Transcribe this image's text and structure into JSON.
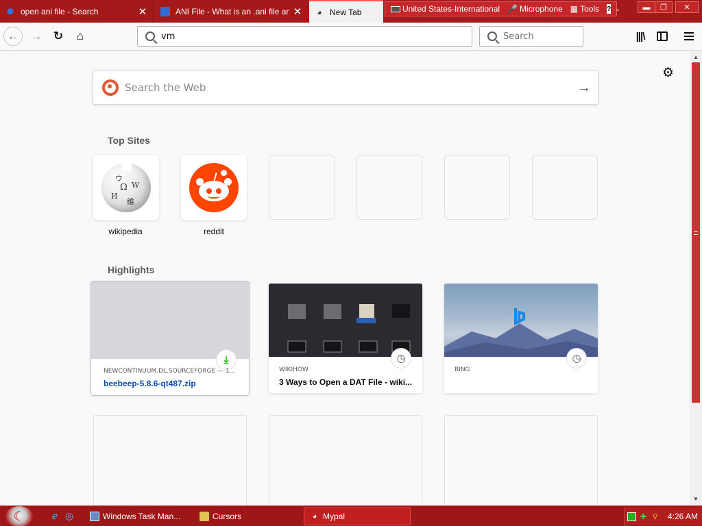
{
  "tabs": [
    {
      "label": "open ani file - Search",
      "favicon": "search-favicon"
    },
    {
      "label": "ANI File - What is an .ani file and",
      "favicon": "document-favicon"
    },
    {
      "label": "New Tab",
      "favicon": "firefox-favicon"
    }
  ],
  "tab_close": "✕",
  "langbar": {
    "keyboard": "United States-International",
    "microphone": "Microphone",
    "tools": "Tools",
    "help": "?"
  },
  "window_controls": {
    "minimize": "▬",
    "maximize": "❐",
    "close": "✕"
  },
  "nav": {
    "back": "←",
    "forward": "→",
    "reload": "↻",
    "home": "⌂",
    "url_value": "vm",
    "search_placeholder": "Search"
  },
  "toolbar_icons": [
    "library-icon",
    "sidebar-icon",
    "menu-icon"
  ],
  "newtab": {
    "web_search_placeholder": "Search the Web",
    "web_search_arrow": "→",
    "settings_icon": "⚙",
    "top_sites_title": "Top Sites",
    "top_sites": [
      {
        "label": "wikipedia"
      },
      {
        "label": "reddit"
      }
    ],
    "highlights_title": "Highlights",
    "highlights": [
      {
        "hostname": "NEWCONTINUUM.DL.SOURCEFORGE — 1...",
        "title": "beebeep-5.8.6-qt487.zip",
        "badge": "⤓"
      },
      {
        "hostname": "WIKIHOW",
        "title": "3 Ways to Open a DAT File - wiki...",
        "badge": "◷"
      },
      {
        "hostname": "BING",
        "title": "",
        "badge": "◷"
      }
    ],
    "wiki_glyphs": [
      "Ω",
      "W",
      "И",
      "ウ",
      "維"
    ]
  },
  "taskbar": {
    "items": [
      {
        "label": "Windows Task Man..."
      },
      {
        "label": "Cursors"
      },
      {
        "label": "Mypal"
      }
    ],
    "clock": "4:26 AM"
  },
  "colors": {
    "accent": "#a41a1a",
    "active_tab": "#f1f1f1",
    "duckduckgo": "#de5833",
    "reddit": "#ff4500",
    "download_green": "#12bc00",
    "download_link": "#0a4cab"
  }
}
